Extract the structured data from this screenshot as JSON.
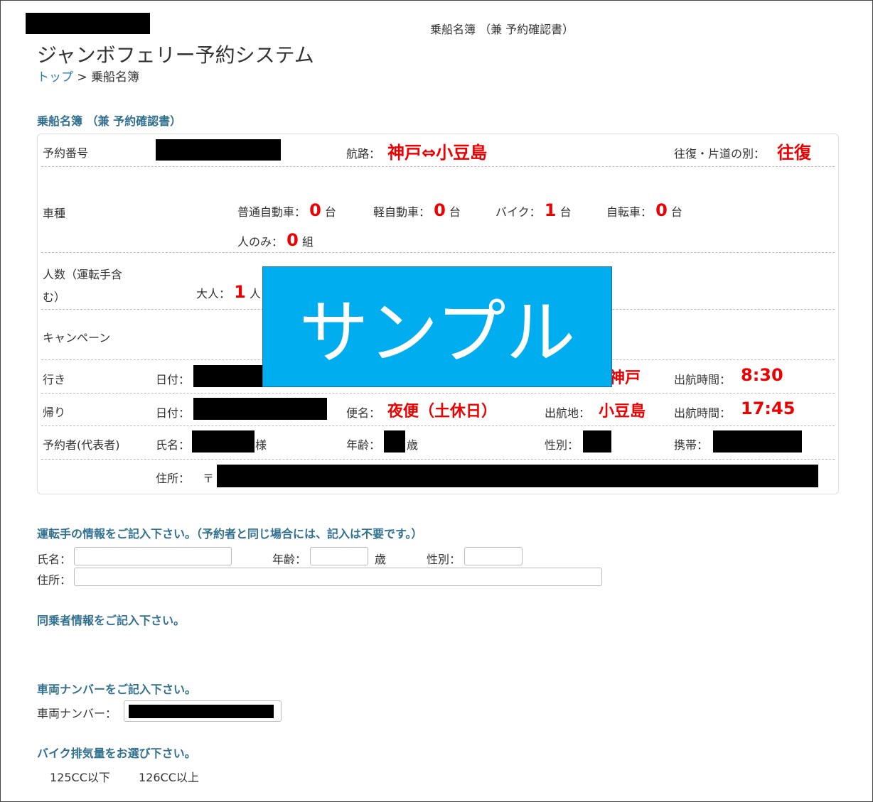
{
  "header": {
    "doc_title": "乗船名簿 （兼 予約確認書）",
    "app_title": "ジャンボフェリー予約システム",
    "breadcrumb_home": "トップ",
    "breadcrumb_sep": ">",
    "breadcrumb_current": "乗船名簿"
  },
  "section_title": "乗船名簿 （兼 予約確認書）",
  "reservation": {
    "number_label": "予約番号",
    "route_label": "航路：",
    "route": "神戸⇔小豆島",
    "trip_type_label": "往復・片道の別：",
    "trip_type": "往復",
    "vehicle_label": "車種",
    "vehicles": [
      {
        "label": "普通自動車：",
        "count": "0",
        "unit": "台"
      },
      {
        "label": "軽自動車：",
        "count": "0",
        "unit": "台"
      },
      {
        "label": "バイク：",
        "count": "1",
        "unit": "台"
      },
      {
        "label": "自転車：",
        "count": "0",
        "unit": "台"
      },
      {
        "label": "人のみ：",
        "count": "0",
        "unit": "組"
      }
    ],
    "people_label": "人数（運転手含む）",
    "adult_label": "大人：",
    "adult_count": "1",
    "adult_unit": "人",
    "campaign_label": "キャンペーン",
    "outbound": {
      "label": "行き",
      "date_label": "日付：",
      "departure_port_partial": "神戸",
      "time_label": "出航時間：",
      "time": "8:30"
    },
    "return": {
      "label": "帰り",
      "date_label": "日付：",
      "flight_label": "便名：",
      "flight": "夜便（土休日）",
      "port_label": "出航地：",
      "port": "小豆島",
      "time_label": "出航時間：",
      "time": "17:45"
    },
    "rep_label": "予約者(代表者)",
    "name_label": "氏名：",
    "name_suffix": "様",
    "age_label": "年齢：",
    "age_unit": "歳",
    "sex_label": "性別：",
    "mobile_label": "携帯：",
    "address_label": "住所：",
    "postal_mark": "〒"
  },
  "sample_stamp": "サンプル",
  "driver": {
    "title": "運転手の情報をご記入下さい。（予約者と同じ場合には、記入は不要です。）",
    "name_label": "氏名：",
    "age_label": "年齢：",
    "age_unit": "歳",
    "sex_label": "性別：",
    "address_label": "住所："
  },
  "companions_title": "同乗者情報をご記入下さい。",
  "vehicle_number": {
    "title": "車両ナンバーをご記入下さい。",
    "label": "車両ナンバー："
  },
  "bike": {
    "title": "バイク排気量をお選び下さい。",
    "options": [
      "125CC以下",
      "126CC以上"
    ]
  }
}
